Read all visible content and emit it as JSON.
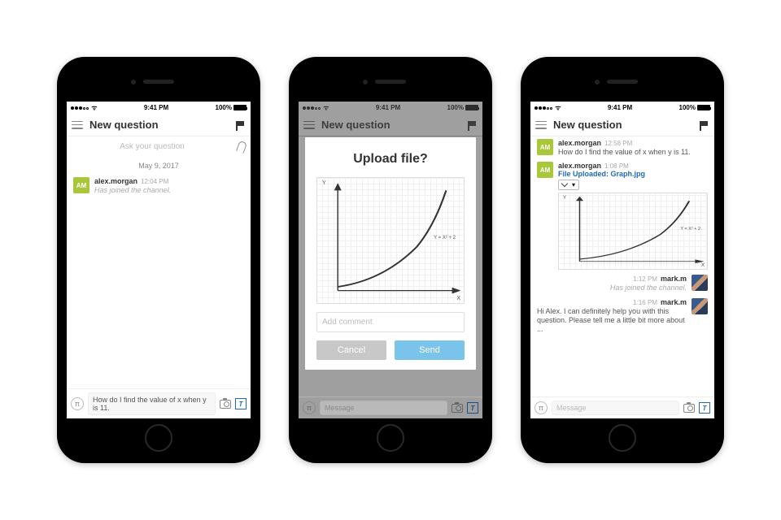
{
  "status": {
    "time": "9:41 PM",
    "battery": "100%"
  },
  "header": {
    "title": "New question",
    "ask_placeholder": "Ask your question"
  },
  "phone1": {
    "date_sep": "May 9, 2017",
    "msg1": {
      "user": "alex.morgan",
      "time": "12:04 PM",
      "text": "Has joined the channel.",
      "avatar": "AM"
    },
    "input_value": "How do I find the value of x when y is 11."
  },
  "phone2": {
    "modal_title": "Upload file?",
    "comment_placeholder": "Add comment",
    "cancel": "Cancel",
    "send": "Send",
    "hidden_input": "Message"
  },
  "phone3": {
    "msg1": {
      "user": "alex.morgan",
      "time": "12:58 PM",
      "avatar": "AM",
      "text": "How do I find the value of x  when y is 11."
    },
    "msg2": {
      "user": "alex.morgan",
      "time": "1:08 PM",
      "avatar": "AM",
      "file_label": "File Uploaded: Graph.jpg"
    },
    "msg3": {
      "user": "mark.m",
      "time": "1:12 PM",
      "text": "Has joined the channel."
    },
    "msg4": {
      "user": "mark.m",
      "time": "1:16 PM",
      "text": "Hi Alex. I can definitely help you with this question. Please tell me a little bit more about ..."
    },
    "input_placeholder": "Message"
  },
  "chart_data": {
    "type": "line",
    "title": "",
    "annotation": "Y = X² + 2",
    "xlabel": "X",
    "ylabel": "Y",
    "x": [
      0,
      0.5,
      1,
      1.5,
      2,
      2.5,
      3,
      3.5
    ],
    "y": [
      2,
      2.25,
      3,
      4.25,
      6,
      8.25,
      11,
      14.25
    ],
    "xlim": [
      0,
      4
    ],
    "ylim": [
      0,
      16
    ]
  }
}
